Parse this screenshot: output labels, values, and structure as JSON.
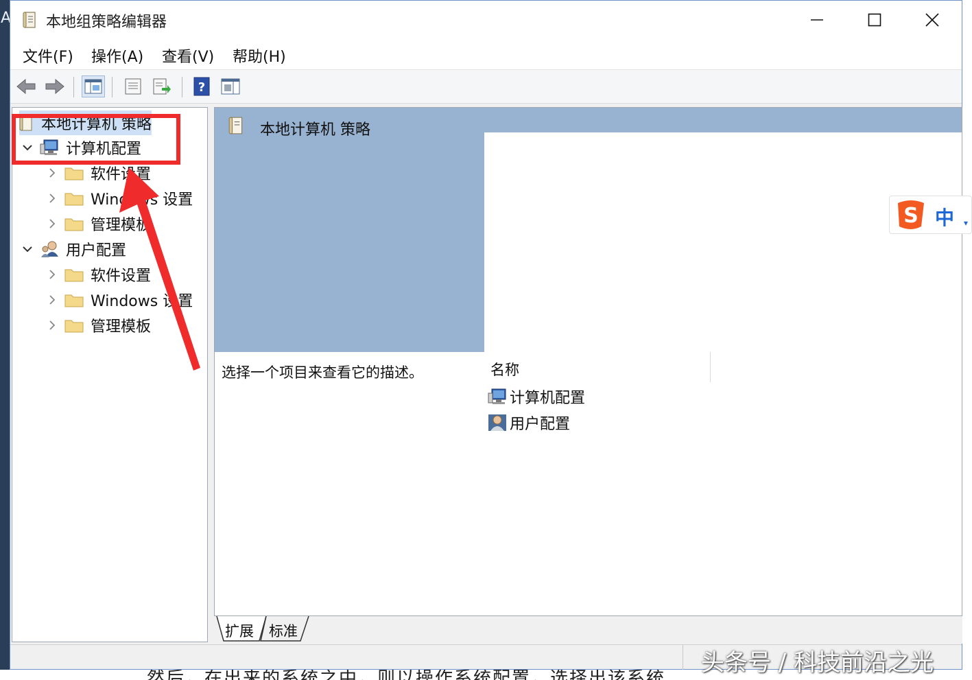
{
  "background": {
    "left_text": "A",
    "bottom_text": "然后，在出来的系统之中，则以操作系统配置，选择出该系统"
  },
  "window": {
    "title": "本地组策略编辑器",
    "controls": {
      "minimize": "—",
      "maximize": "☐",
      "close": "✕"
    }
  },
  "menu": {
    "file": "文件(F)",
    "action": "操作(A)",
    "view": "查看(V)",
    "help": "帮助(H)"
  },
  "toolbar": {
    "icons": [
      "back-arrow-icon",
      "forward-arrow-icon",
      "show-tree-icon",
      "properties-icon",
      "export-list-icon",
      "help-icon",
      "show-hide-icon"
    ]
  },
  "tree": {
    "root": "本地计算机 策略",
    "computer_config": "计算机配置",
    "computer_children": [
      "软件设置",
      "Windows 设置",
      "管理模板"
    ],
    "user_config": "用户配置",
    "user_children": [
      "软件设置",
      "Windows 设置",
      "管理模板"
    ]
  },
  "right": {
    "header_title": "本地计算机 策略",
    "description": "选择一个项目来查看它的描述。",
    "column_name": "名称",
    "items": [
      "计算机配置",
      "用户配置"
    ]
  },
  "tabs": {
    "extended": "扩展",
    "standard": "标准"
  },
  "ime": {
    "mode": "中",
    "logo": "S"
  },
  "watermark": "头条号 / 科技前沿之光",
  "colors": {
    "selection_blue": "#98b2d1",
    "annotation_red": "#ef2b2b",
    "window_border": "#6f93c9"
  }
}
